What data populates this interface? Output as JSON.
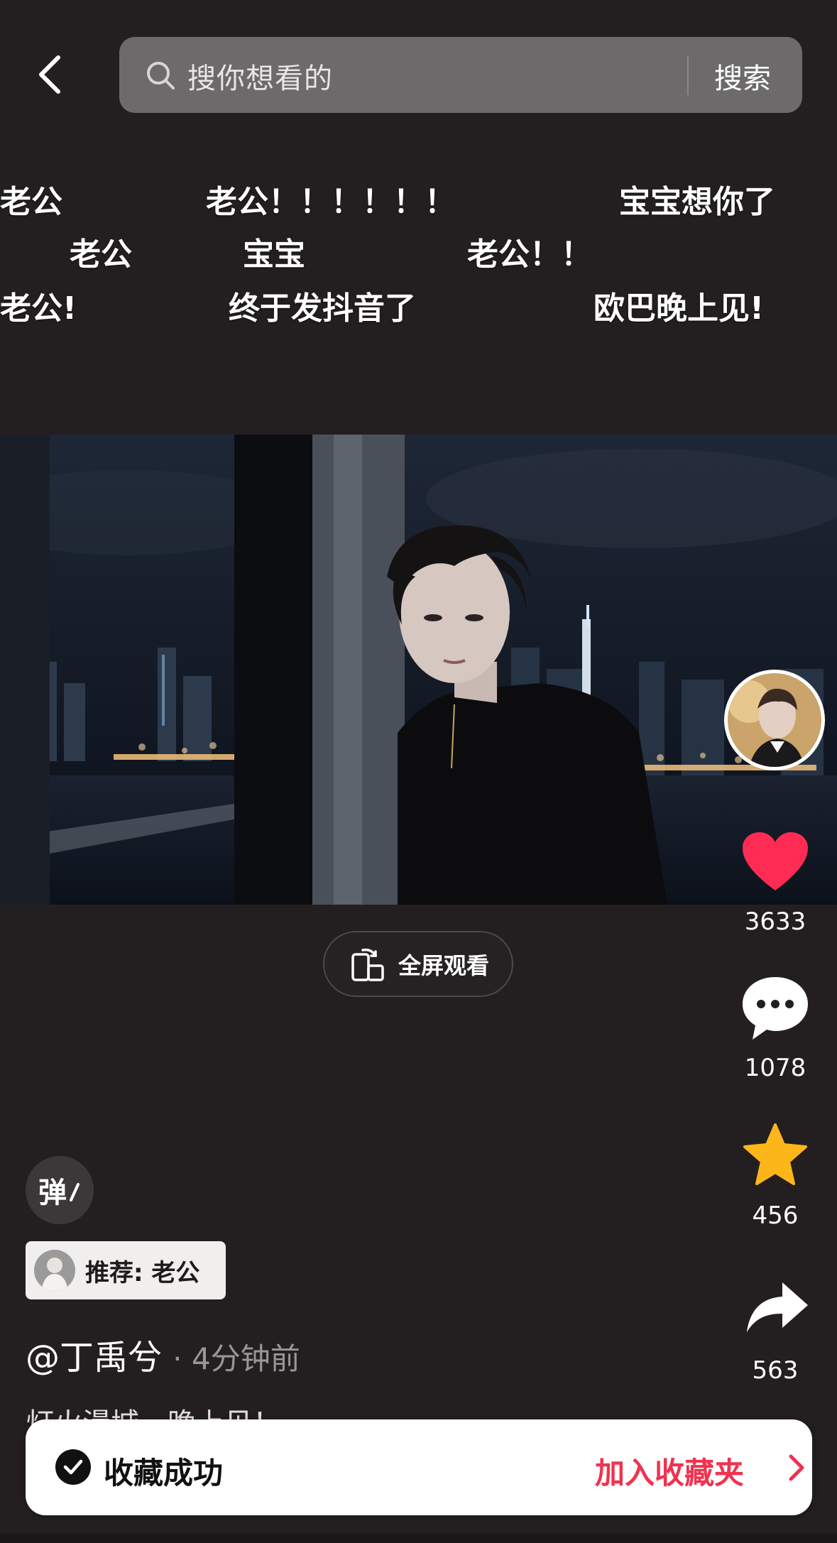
{
  "search": {
    "placeholder": "搜你想看的",
    "button": "搜索"
  },
  "danmaku": [
    "老公",
    "老公！！！！！！",
    "宝宝想你了",
    "老公",
    "宝宝",
    "老公！！",
    "老公!",
    "终于发抖音了",
    "欧巴晚上见!"
  ],
  "fullscreen": {
    "label": "全屏观看"
  },
  "stats": {
    "likes": "3633",
    "comments": "1078",
    "favorites": "456",
    "shares": "563"
  },
  "colors": {
    "like": "#fe2c55",
    "favorite": "#fdb61a",
    "accent": "#f0324f",
    "background": "#231f20"
  },
  "danmu_toggle": "弹",
  "recommend": {
    "label": "推荐: 老公"
  },
  "author": {
    "name": "@丁禹兮",
    "time": "· 4分钟前"
  },
  "caption": "灯火漫城，晚上见！ ··",
  "toast": {
    "message": "收藏成功",
    "action": "加入收藏夹"
  },
  "icons": [
    "back-icon",
    "search-icon",
    "phone-rotate-icon",
    "heart-icon",
    "comment-icon",
    "star-icon",
    "share-icon",
    "check-icon",
    "chevron-right-icon"
  ]
}
